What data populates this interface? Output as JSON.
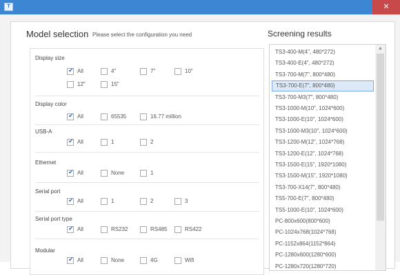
{
  "app": {
    "icon_text": "T",
    "close_symbol": "✕"
  },
  "header": {
    "title": "Model selection",
    "subtitle": "Please select the configuration you need"
  },
  "groups": {
    "display_size": {
      "label": "Display size",
      "options": [
        "All",
        "4\"",
        "7\"",
        "10\"",
        "12\"",
        "15\""
      ]
    },
    "display_color": {
      "label": "Display color",
      "options": [
        "All",
        "65535",
        "16.77 million"
      ]
    },
    "usb_a": {
      "label": "USB-A",
      "options": [
        "All",
        "1",
        "2"
      ]
    },
    "ethernet": {
      "label": "Ethernet",
      "options": [
        "All",
        "None",
        "1"
      ]
    },
    "serial_port": {
      "label": "Serial port",
      "options": [
        "All",
        "1",
        "2",
        "3"
      ]
    },
    "serial_port_type": {
      "label": "Serial port type",
      "options": [
        "All",
        "RS232",
        "RS485",
        "RS422"
      ]
    },
    "modular": {
      "label": "Modular",
      "options": [
        "All",
        "None",
        "4G",
        "Wifi"
      ]
    }
  },
  "results": {
    "title": "Screening results",
    "selected_index": 3,
    "items": [
      "TS3-400-M(4\", 480*272)",
      "TS3-400-E(4\", 480*272)",
      "TS3-700-M(7\", 800*480)",
      "TS3-700-E(7\", 800*480)",
      "TS3-700-M3(7\", 800*480)",
      "TS3-1000-M(10\", 1024*600)",
      "TS3-1000-E(10\", 1024*600)",
      "TS3-1000-M3(10\", 1024*600)",
      "TS3-1200-M(12\", 1024*768)",
      "TS3-1200-E(12\", 1024*768)",
      "TS3-1500-E(15\", 1920*1080)",
      "TS3-1500-M(15\", 1920*1080)",
      "TS3-700-X14(7\", 800*480)",
      "TS5-700-E(7\", 800*480)",
      "TS5-1000-E(10\", 1024*600)",
      "PC-800x600(800*600)",
      "PC-1024x768(1024*768)",
      "PC-1152x864(1152*864)",
      "PC-1280x600(1280*600)",
      "PC-1280x720(1280*720)"
    ]
  }
}
